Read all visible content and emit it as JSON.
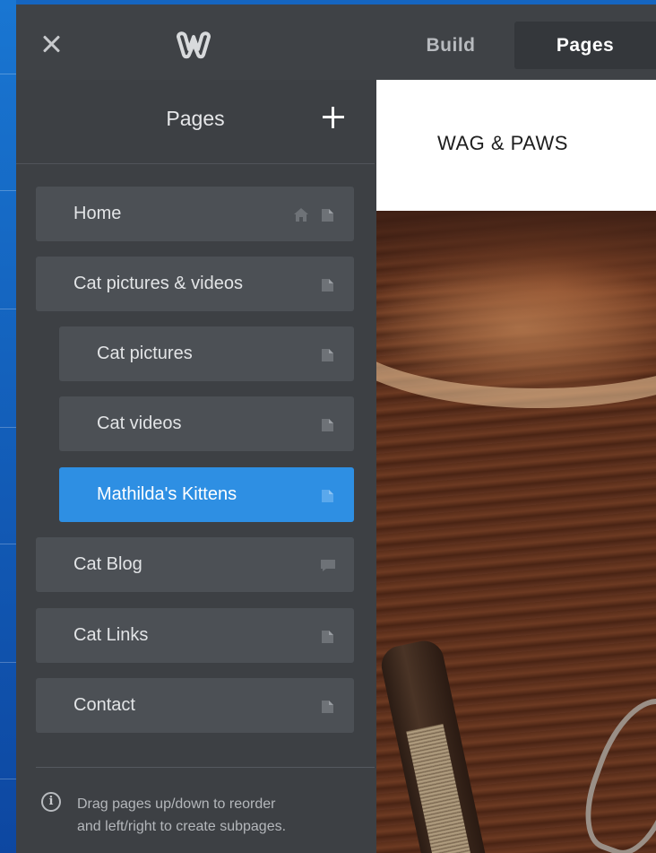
{
  "topbar": {
    "logo_alt": "Weebly",
    "tabs": [
      {
        "label": "Build",
        "active": false
      },
      {
        "label": "Pages",
        "active": true
      }
    ]
  },
  "sidebar": {
    "title": "Pages",
    "pages": [
      {
        "label": "Home",
        "level": 0,
        "icons": [
          "home-icon",
          "page-icon"
        ],
        "active": false
      },
      {
        "label": "Cat pictures & videos",
        "level": 0,
        "icons": [
          "page-icon"
        ],
        "active": false
      },
      {
        "label": "Cat pictures",
        "level": 1,
        "icons": [
          "page-icon"
        ],
        "active": false
      },
      {
        "label": "Cat videos",
        "level": 1,
        "icons": [
          "page-icon"
        ],
        "active": false
      },
      {
        "label": "Mathilda's Kittens",
        "level": 1,
        "icons": [
          "page-icon"
        ],
        "active": true
      },
      {
        "label": "Cat Blog",
        "level": 0,
        "icons": [
          "blog-icon"
        ],
        "active": false
      },
      {
        "label": "Cat Links",
        "level": 0,
        "icons": [
          "page-icon"
        ],
        "active": false
      },
      {
        "label": "Contact",
        "level": 0,
        "icons": [
          "page-icon"
        ],
        "active": false
      }
    ],
    "help_line1": "Drag pages up/down to reorder",
    "help_line2": "and left/right to create subpages."
  },
  "preview": {
    "site_name": "WAG & PAWS"
  },
  "colors": {
    "active": "#2e8fe3",
    "sidebar_bg": "#3d4044",
    "item_bg": "#4c5055"
  }
}
